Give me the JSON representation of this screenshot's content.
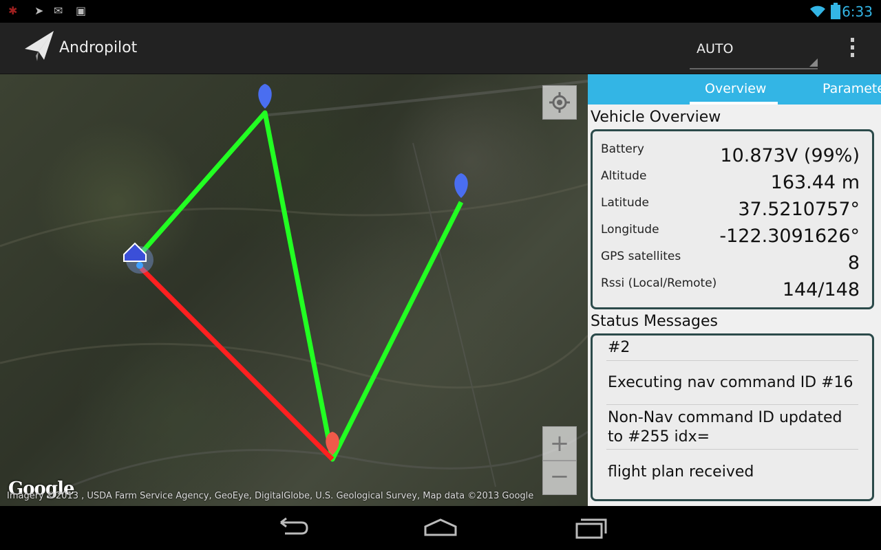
{
  "status_bar": {
    "time": "6:33",
    "left_icons": [
      "bug-icon",
      "send-icon",
      "gmail-icon",
      "store-bag-icon"
    ],
    "right_icons": [
      "wifi-icon",
      "battery-icon"
    ],
    "accent": "#33b5e5"
  },
  "action_bar": {
    "title": "Andropilot",
    "mode": "AUTO"
  },
  "map": {
    "attribution": "Imagery ©2013 , USDA Farm Service Agency, GeoEye, DigitalGlobe, U.S. Geological Survey, Map data ©2013 Google",
    "logo": "Google",
    "route_colors": {
      "green": "#22ff22",
      "red": "#ff2020"
    },
    "zoom_in": "+",
    "zoom_out": "−"
  },
  "panel": {
    "tabs": [
      {
        "label": "Overview",
        "active": true
      },
      {
        "label": "Parameters",
        "active": false
      }
    ],
    "overview_title": "Vehicle Overview",
    "overview_rows": [
      {
        "label": "Battery",
        "value": "10.873V  (99%)"
      },
      {
        "label": "Altitude",
        "value": "163.44 m"
      },
      {
        "label": "Latitude",
        "value": "37.5210757°"
      },
      {
        "label": "Longitude",
        "value": "-122.3091626°"
      },
      {
        "label": "GPS satellites",
        "value": "8"
      },
      {
        "label": "Rssi (Local/Remote)",
        "value": "144/148"
      }
    ],
    "status_title": "Status Messages",
    "messages": [
      "#2",
      "Executing nav command ID #16",
      "Non-Nav command ID updated to #255 idx=",
      "flight plan received"
    ]
  },
  "nav_bar": {
    "buttons": [
      "back-icon",
      "home-icon",
      "recent-apps-icon"
    ]
  }
}
